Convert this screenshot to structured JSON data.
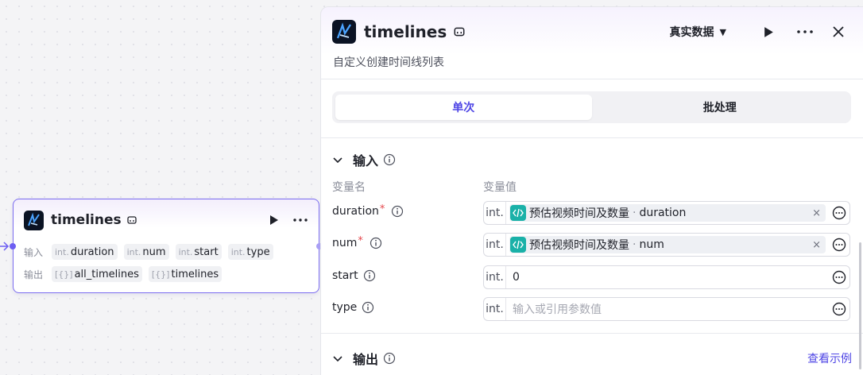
{
  "node": {
    "title": "timelines",
    "input_label": "输入",
    "output_label": "输出",
    "inputs": [
      {
        "type": "int.",
        "name": "duration"
      },
      {
        "type": "int.",
        "name": "num"
      },
      {
        "type": "int.",
        "name": "start"
      },
      {
        "type": "int.",
        "name": "type"
      }
    ],
    "outputs": [
      {
        "type": "[{}]",
        "name": "all_timelines"
      },
      {
        "type": "[{}]",
        "name": "timelines"
      }
    ]
  },
  "panel": {
    "title": "timelines",
    "real_data_label": "真实数据",
    "description": "自定义创建时间线列表",
    "tabs": [
      {
        "label": "单次",
        "active": true
      },
      {
        "label": "批处理",
        "active": false
      }
    ],
    "input_section": {
      "title": "输入",
      "col_name": "变量名",
      "col_value": "变量值",
      "rows": [
        {
          "name": "duration",
          "required": "*",
          "type": "int.",
          "ref_node": "预估视频时间及数量",
          "ref_sep": "·",
          "ref_field": "duration",
          "clear": "×"
        },
        {
          "name": "num",
          "required": "*",
          "type": "int.",
          "ref_node": "预估视频时间及数量",
          "ref_sep": "·",
          "ref_field": "num",
          "clear": "×"
        },
        {
          "name": "start",
          "type": "int.",
          "value": "0"
        },
        {
          "name": "type",
          "type": "int.",
          "placeholder": "输入或引用参数值"
        }
      ]
    },
    "output_section": {
      "title": "输出",
      "view_example": "查看示例"
    }
  },
  "colors": {
    "accent": "#4f46e5",
    "node_border": "#7b6cf0",
    "ref_icon": "#1ab1a8",
    "required": "#e5484d"
  }
}
